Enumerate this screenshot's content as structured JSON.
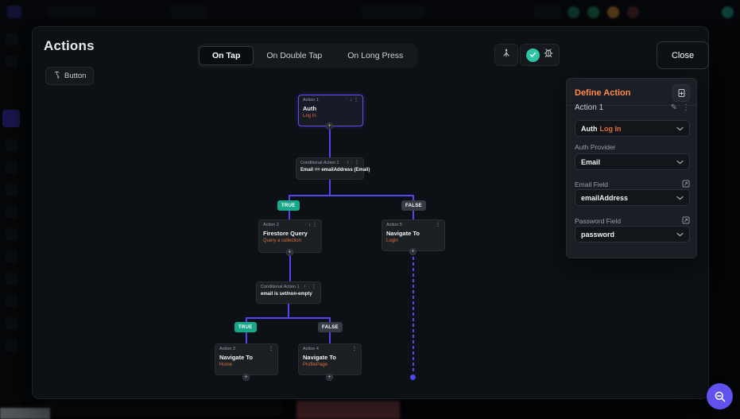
{
  "colors": {
    "accent_purple": "#5246ee",
    "accent_orange": "#ff8a4a",
    "true_badge": "#17a98a",
    "false_badge": "#343b43",
    "modal_bg": "#0d1014",
    "panel_bg": "#191f24"
  },
  "modal": {
    "title": "Actions",
    "trigger_chip": "Button",
    "tabs": [
      {
        "label": "On Tap",
        "active": true
      },
      {
        "label": "On Double Tap",
        "active": false
      },
      {
        "label": "On Long Press",
        "active": false
      }
    ],
    "close_label": "Close"
  },
  "flow": {
    "nodes": [
      {
        "header": "Action 1",
        "title": "Auth",
        "subtitle": "Log In"
      },
      {
        "header": "Conditional Action 1",
        "title": "Email == emailAddress (Email)"
      },
      {
        "header": "Action 2",
        "title": "Firestore Query",
        "subtitle": "Query a collection"
      },
      {
        "header": "Conditional Action 1",
        "title": "email is set/non-empty"
      },
      {
        "header": "Action 3",
        "title": "Navigate To",
        "subtitle": "Home"
      },
      {
        "header": "Action 4",
        "title": "Navigate To",
        "subtitle": "ProfilePage"
      },
      {
        "header": "Action 5",
        "title": "Navigate To",
        "subtitle": "Login"
      }
    ],
    "badges": [
      "TRUE",
      "FALSE",
      "TRUE",
      "FALSE"
    ]
  },
  "panel": {
    "title": "Define Action",
    "action_label": "Action 1",
    "action_type": "Auth",
    "action_type_secondary": "Log In",
    "fields": [
      {
        "label": "Auth Provider",
        "value": "Email"
      },
      {
        "label": "Email Field",
        "value": "emailAddress"
      },
      {
        "label": "Password Field",
        "value": "password"
      }
    ]
  },
  "icons": {
    "kebab": "⋮",
    "arrow_up": "↑",
    "arrow_down": "↓",
    "plus": "+",
    "pencil": "✎"
  }
}
